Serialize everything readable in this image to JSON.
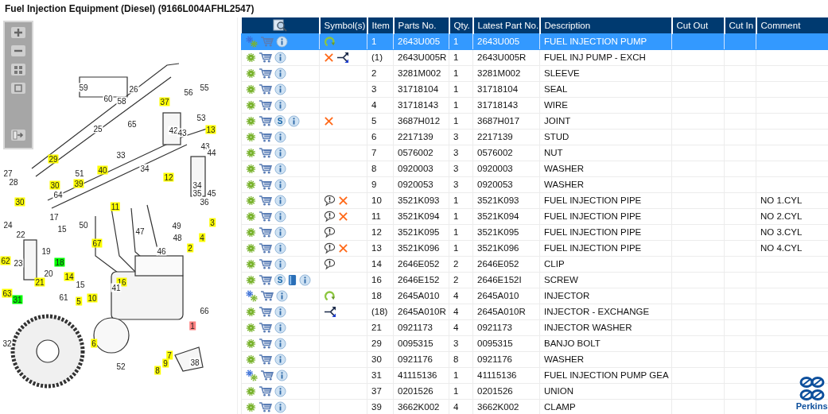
{
  "window": {
    "title": "Fuel Injection Equipment (Diesel) (9166L004AFHL2547)"
  },
  "diagram": {
    "callouts": [
      {
        "label": "59"
      },
      {
        "label": "60"
      },
      {
        "label": "58"
      },
      {
        "label": "26"
      },
      {
        "label": "55"
      },
      {
        "label": "56"
      },
      {
        "label": "37",
        "color": "#ffff00"
      },
      {
        "label": "65"
      },
      {
        "label": "53"
      },
      {
        "label": "25"
      },
      {
        "label": "42"
      },
      {
        "label": "43"
      },
      {
        "label": "13",
        "color": "#ffff00"
      },
      {
        "label": "43"
      },
      {
        "label": "44"
      },
      {
        "label": "33"
      },
      {
        "label": "29",
        "color": "#ffff00"
      },
      {
        "label": "40",
        "color": "#ffff00"
      },
      {
        "label": "34"
      },
      {
        "label": "12",
        "color": "#ffff00"
      },
      {
        "label": "27"
      },
      {
        "label": "51"
      },
      {
        "label": "28"
      },
      {
        "label": "30",
        "color": "#ffff00"
      },
      {
        "label": "39",
        "color": "#ffff00"
      },
      {
        "label": "64"
      },
      {
        "label": "30",
        "color": "#ffff00"
      },
      {
        "label": "11",
        "color": "#ffff00"
      },
      {
        "label": "34"
      },
      {
        "label": "35"
      },
      {
        "label": "45"
      },
      {
        "label": "36"
      },
      {
        "label": "24"
      },
      {
        "label": "17"
      },
      {
        "label": "15"
      },
      {
        "label": "50"
      },
      {
        "label": "47"
      },
      {
        "label": "49"
      },
      {
        "label": "3",
        "color": "#ffff00"
      },
      {
        "label": "22"
      },
      {
        "label": "19"
      },
      {
        "label": "48"
      },
      {
        "label": "4",
        "color": "#ffff00"
      },
      {
        "label": "67",
        "color": "#ffff00"
      },
      {
        "label": "2",
        "color": "#ffff00"
      },
      {
        "label": "46"
      },
      {
        "label": "62",
        "color": "#ffff00"
      },
      {
        "label": "23"
      },
      {
        "label": "18",
        "color": "#00ff00"
      },
      {
        "label": "20"
      },
      {
        "label": "14",
        "color": "#ffff00"
      },
      {
        "label": "21",
        "color": "#ffff00"
      },
      {
        "label": "15"
      },
      {
        "label": "16",
        "color": "#ffff00"
      },
      {
        "label": "41"
      },
      {
        "label": "63",
        "color": "#ffff00"
      },
      {
        "label": "31",
        "color": "#00ff00"
      },
      {
        "label": "61"
      },
      {
        "label": "5",
        "color": "#ffff00"
      },
      {
        "label": "10",
        "color": "#ffff00"
      },
      {
        "label": "66"
      },
      {
        "label": "1",
        "color": "#ff8080"
      },
      {
        "label": "32"
      },
      {
        "label": "6",
        "color": "#ffff00"
      },
      {
        "label": "7",
        "color": "#ffff00"
      },
      {
        "label": "38"
      },
      {
        "label": "9",
        "color": "#ffff00"
      },
      {
        "label": "52"
      },
      {
        "label": "8",
        "color": "#ffff00"
      }
    ]
  },
  "table": {
    "columns": [
      "Symbol(s)",
      "Item",
      "Parts No.",
      "Qty.",
      "Latest Part No.",
      "Description",
      "Cut Out",
      "Cut In",
      "Comment"
    ],
    "rows": [
      {
        "selected": true,
        "icons": [
          {
            "kind": "multigear"
          },
          {
            "kind": "cart"
          },
          {
            "kind": "info"
          }
        ],
        "symbols": [
          {
            "kind": "rotate"
          }
        ],
        "item": "1",
        "part": "2643U005",
        "qty": "1",
        "latest": "2643U005",
        "description": "FUEL INJECTION PUMP"
      },
      {
        "selected": false,
        "icons": [
          {
            "kind": "gear"
          },
          {
            "kind": "cart"
          },
          {
            "kind": "info"
          }
        ],
        "symbols": [
          {
            "kind": "cross"
          },
          {
            "kind": "split"
          }
        ],
        "item": "(1)",
        "part": "2643U005R",
        "qty": "1",
        "latest": "2643U005R",
        "description": "FUEL INJ PUMP - EXCH"
      },
      {
        "selected": false,
        "icons": [
          {
            "kind": "gear"
          },
          {
            "kind": "cart"
          },
          {
            "kind": "info"
          }
        ],
        "item": "2",
        "part": "3281M002",
        "qty": "1",
        "latest": "3281M002",
        "description": "SLEEVE"
      },
      {
        "selected": false,
        "icons": [
          {
            "kind": "gear"
          },
          {
            "kind": "cart"
          },
          {
            "kind": "info"
          }
        ],
        "item": "3",
        "part": "31718104",
        "qty": "1",
        "latest": "31718104",
        "description": "SEAL"
      },
      {
        "selected": false,
        "icons": [
          {
            "kind": "gear"
          },
          {
            "kind": "cart"
          },
          {
            "kind": "info"
          }
        ],
        "item": "4",
        "part": "31718143",
        "qty": "1",
        "latest": "31718143",
        "description": "WIRE"
      },
      {
        "selected": false,
        "icons": [
          {
            "kind": "gear"
          },
          {
            "kind": "cart"
          },
          {
            "kind": "badge",
            "text": "S"
          },
          {
            "kind": "info"
          }
        ],
        "symbols": [
          {
            "kind": "cross"
          }
        ],
        "item": "5",
        "part": "3687H012",
        "qty": "1",
        "latest": "3687H017",
        "description": "JOINT"
      },
      {
        "selected": false,
        "icons": [
          {
            "kind": "gear"
          },
          {
            "kind": "cart"
          },
          {
            "kind": "info"
          }
        ],
        "item": "6",
        "part": "2217139",
        "qty": "3",
        "latest": "2217139",
        "description": "STUD"
      },
      {
        "selected": false,
        "icons": [
          {
            "kind": "gear"
          },
          {
            "kind": "cart"
          },
          {
            "kind": "info"
          }
        ],
        "item": "7",
        "part": "0576002",
        "qty": "3",
        "latest": "0576002",
        "description": "NUT"
      },
      {
        "selected": false,
        "icons": [
          {
            "kind": "gear"
          },
          {
            "kind": "cart"
          },
          {
            "kind": "info"
          }
        ],
        "item": "8",
        "part": "0920003",
        "qty": "3",
        "latest": "0920003",
        "description": "WASHER"
      },
      {
        "selected": false,
        "icons": [
          {
            "kind": "gear"
          },
          {
            "kind": "cart"
          },
          {
            "kind": "info"
          }
        ],
        "item": "9",
        "part": "0920053",
        "qty": "3",
        "latest": "0920053",
        "description": "WASHER"
      },
      {
        "selected": false,
        "icons": [
          {
            "kind": "gear"
          },
          {
            "kind": "cart"
          },
          {
            "kind": "info"
          }
        ],
        "symbols": [
          {
            "kind": "note"
          },
          {
            "kind": "cross"
          }
        ],
        "item": "10",
        "part": "3521K093",
        "qty": "1",
        "latest": "3521K093",
        "description": "FUEL INJECTION PIPE",
        "comment": "NO 1.CYL"
      },
      {
        "selected": false,
        "icons": [
          {
            "kind": "gear"
          },
          {
            "kind": "cart"
          },
          {
            "kind": "info"
          }
        ],
        "symbols": [
          {
            "kind": "note"
          },
          {
            "kind": "cross"
          }
        ],
        "item": "11",
        "part": "3521K094",
        "qty": "1",
        "latest": "3521K094",
        "description": "FUEL INJECTION PIPE",
        "comment": "NO 2.CYL"
      },
      {
        "selected": false,
        "icons": [
          {
            "kind": "gear"
          },
          {
            "kind": "cart"
          },
          {
            "kind": "info"
          }
        ],
        "symbols": [
          {
            "kind": "note"
          }
        ],
        "item": "12",
        "part": "3521K095",
        "qty": "1",
        "latest": "3521K095",
        "description": "FUEL INJECTION PIPE",
        "comment": "NO 3.CYL"
      },
      {
        "selected": false,
        "icons": [
          {
            "kind": "gear"
          },
          {
            "kind": "cart"
          },
          {
            "kind": "info"
          }
        ],
        "symbols": [
          {
            "kind": "note"
          },
          {
            "kind": "cross"
          }
        ],
        "item": "13",
        "part": "3521K096",
        "qty": "1",
        "latest": "3521K096",
        "description": "FUEL INJECTION PIPE",
        "comment": "NO 4.CYL"
      },
      {
        "selected": false,
        "icons": [
          {
            "kind": "gear"
          },
          {
            "kind": "cart"
          },
          {
            "kind": "info"
          }
        ],
        "symbols": [
          {
            "kind": "note"
          }
        ],
        "item": "14",
        "part": "2646E052",
        "qty": "2",
        "latest": "2646E052",
        "description": "CLIP"
      },
      {
        "selected": false,
        "icons": [
          {
            "kind": "gear"
          },
          {
            "kind": "cart"
          },
          {
            "kind": "badge",
            "text": "S"
          },
          {
            "kind": "book"
          },
          {
            "kind": "info"
          }
        ],
        "item": "16",
        "part": "2646E152",
        "qty": "2",
        "latest": "2646E152I",
        "description": "SCREW"
      },
      {
        "selected": false,
        "icons": [
          {
            "kind": "multigear"
          },
          {
            "kind": "cart"
          },
          {
            "kind": "info"
          }
        ],
        "symbols": [
          {
            "kind": "rotate"
          }
        ],
        "item": "18",
        "part": "2645A010",
        "qty": "4",
        "latest": "2645A010",
        "description": "INJECTOR"
      },
      {
        "selected": false,
        "icons": [
          {
            "kind": "gear"
          },
          {
            "kind": "cart"
          },
          {
            "kind": "info"
          }
        ],
        "symbols": [
          {
            "kind": "split"
          }
        ],
        "item": "(18)",
        "part": "2645A010R",
        "qty": "4",
        "latest": "2645A010R",
        "description": "INJECTOR - EXCHANGE"
      },
      {
        "selected": false,
        "icons": [
          {
            "kind": "gear"
          },
          {
            "kind": "cart"
          },
          {
            "kind": "info"
          }
        ],
        "item": "21",
        "part": "0921173",
        "qty": "4",
        "latest": "0921173",
        "description": "INJECTOR WASHER"
      },
      {
        "selected": false,
        "icons": [
          {
            "kind": "gear"
          },
          {
            "kind": "cart"
          },
          {
            "kind": "info"
          }
        ],
        "item": "29",
        "part": "0095315",
        "qty": "3",
        "latest": "0095315",
        "description": "BANJO BOLT"
      },
      {
        "selected": false,
        "icons": [
          {
            "kind": "gear"
          },
          {
            "kind": "cart"
          },
          {
            "kind": "info"
          }
        ],
        "item": "30",
        "part": "0921176",
        "qty": "8",
        "latest": "0921176",
        "description": "WASHER"
      },
      {
        "selected": false,
        "icons": [
          {
            "kind": "multigear"
          },
          {
            "kind": "cart"
          },
          {
            "kind": "info"
          }
        ],
        "item": "31",
        "part": "41115136",
        "qty": "1",
        "latest": "41115136",
        "description": "FUEL INJECTION PUMP GEA"
      },
      {
        "selected": false,
        "icons": [
          {
            "kind": "gear"
          },
          {
            "kind": "cart"
          },
          {
            "kind": "info"
          }
        ],
        "item": "37",
        "part": "0201526",
        "qty": "1",
        "latest": "0201526",
        "description": "UNION"
      },
      {
        "selected": false,
        "icons": [
          {
            "kind": "gear"
          },
          {
            "kind": "cart"
          },
          {
            "kind": "info"
          }
        ],
        "item": "39",
        "part": "3662K002",
        "qty": "4",
        "latest": "3662K002",
        "description": "CLAMP"
      }
    ]
  },
  "brand": {
    "name": "Perkins"
  }
}
